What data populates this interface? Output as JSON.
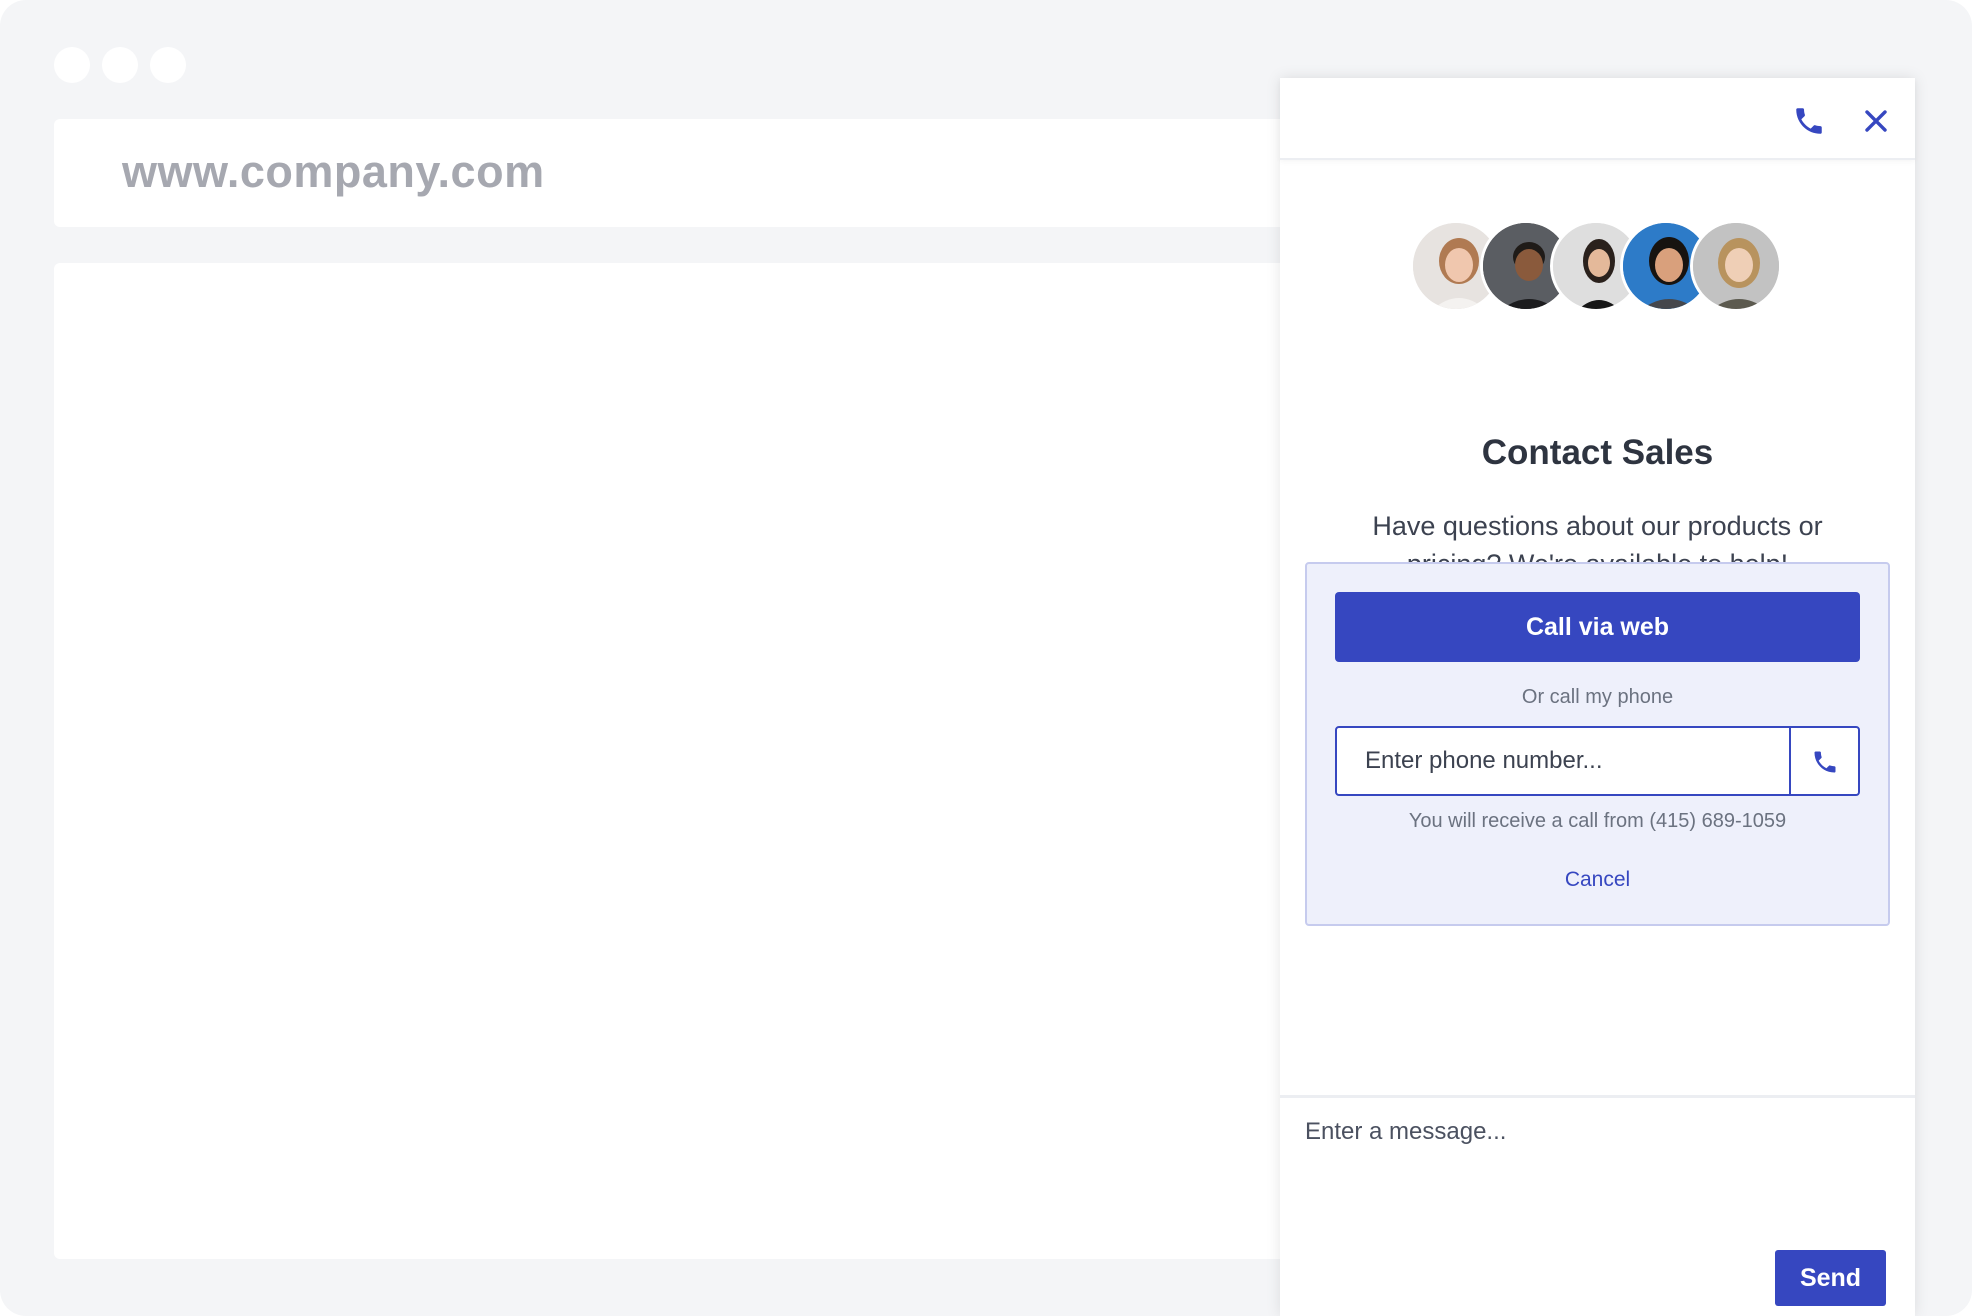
{
  "browser": {
    "url": "www.company.com"
  },
  "widget": {
    "header": {
      "phone_icon": "phone-icon",
      "close_icon": "close-icon"
    },
    "title": "Contact Sales",
    "description": "Have questions about our products or pricing? We're available to help!",
    "call_panel": {
      "call_web_label": "Call via web",
      "or_call_text": "Or call my phone",
      "phone_placeholder": "Enter phone number...",
      "phone_value": "",
      "receive_note": "You will receive a call from (415) 689-1059",
      "cancel_label": "Cancel"
    },
    "compose": {
      "message_placeholder": "Enter a message...",
      "message_value": "",
      "send_label": "Send"
    }
  },
  "colors": {
    "accent": "#3647c0",
    "panel_bg": "#eef0fb",
    "frame_bg": "#f4f5f7"
  }
}
